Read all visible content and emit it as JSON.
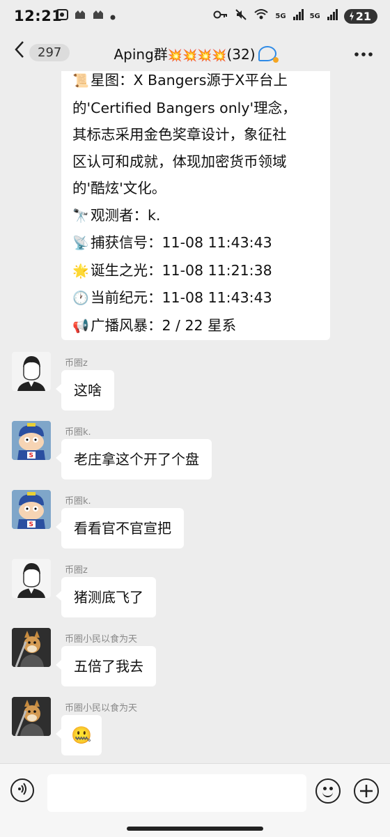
{
  "status_bar": {
    "time": "12:21",
    "network_1": "5G",
    "network_2": "5G",
    "battery": "21",
    "icons": [
      "screenshot-icon",
      "app-icon",
      "app-icon",
      "dot-icon",
      "key-icon",
      "mute-icon",
      "wifi-icon",
      "signal-icon",
      "signal-icon",
      "battery-icon"
    ]
  },
  "header": {
    "back_count": "297",
    "title": "Aping群",
    "title_emojis": "💥💥💥💥",
    "member_count": "(32)"
  },
  "top_message": {
    "lines": [
      {
        "emoji": "📜",
        "text": "星图：X Bangers源于X平台上"
      },
      {
        "emoji": "",
        "text": "的'Certified Bangers only'理念，"
      },
      {
        "emoji": "",
        "text": "其标志采用金色奖章设计，象征社"
      },
      {
        "emoji": "",
        "text": "区认可和成就，体现加密货币领域"
      },
      {
        "emoji": "",
        "text": "的'酷炫'文化。"
      },
      {
        "emoji": "🔭",
        "text": "观测者：k."
      },
      {
        "emoji": "📡",
        "text": "捕获信号：11-08 11:43:43"
      },
      {
        "emoji": "🌟",
        "text": "诞生之光：11-08 11:21:38"
      },
      {
        "emoji": "🕐",
        "text": "当前纪元：11-08 11:43:43"
      },
      {
        "emoji": "📢",
        "text": "广播风暴：2 / 22 星系"
      }
    ]
  },
  "messages": [
    {
      "sender": "币圈z",
      "text": "这啥",
      "avatar": "man-avatar"
    },
    {
      "sender": "币圈k.",
      "text": "老庄拿这个开了个盘",
      "avatar": "cartoon-avatar"
    },
    {
      "sender": "币圈k.",
      "text": "看看官不官宣把",
      "avatar": "cartoon-avatar"
    },
    {
      "sender": "币圈z",
      "text": "猪测底飞了",
      "avatar": "man-avatar"
    },
    {
      "sender": "币圈小民以食为天",
      "text": "五倍了我去",
      "avatar": "dog-avatar"
    },
    {
      "sender": "币圈小民以食为天",
      "text": "🤐",
      "avatar": "dog-avatar"
    }
  ],
  "input": {
    "placeholder": ""
  },
  "colors": {
    "background": "#ededed",
    "bubble": "#ffffff",
    "accent": "#2e8ae6"
  }
}
